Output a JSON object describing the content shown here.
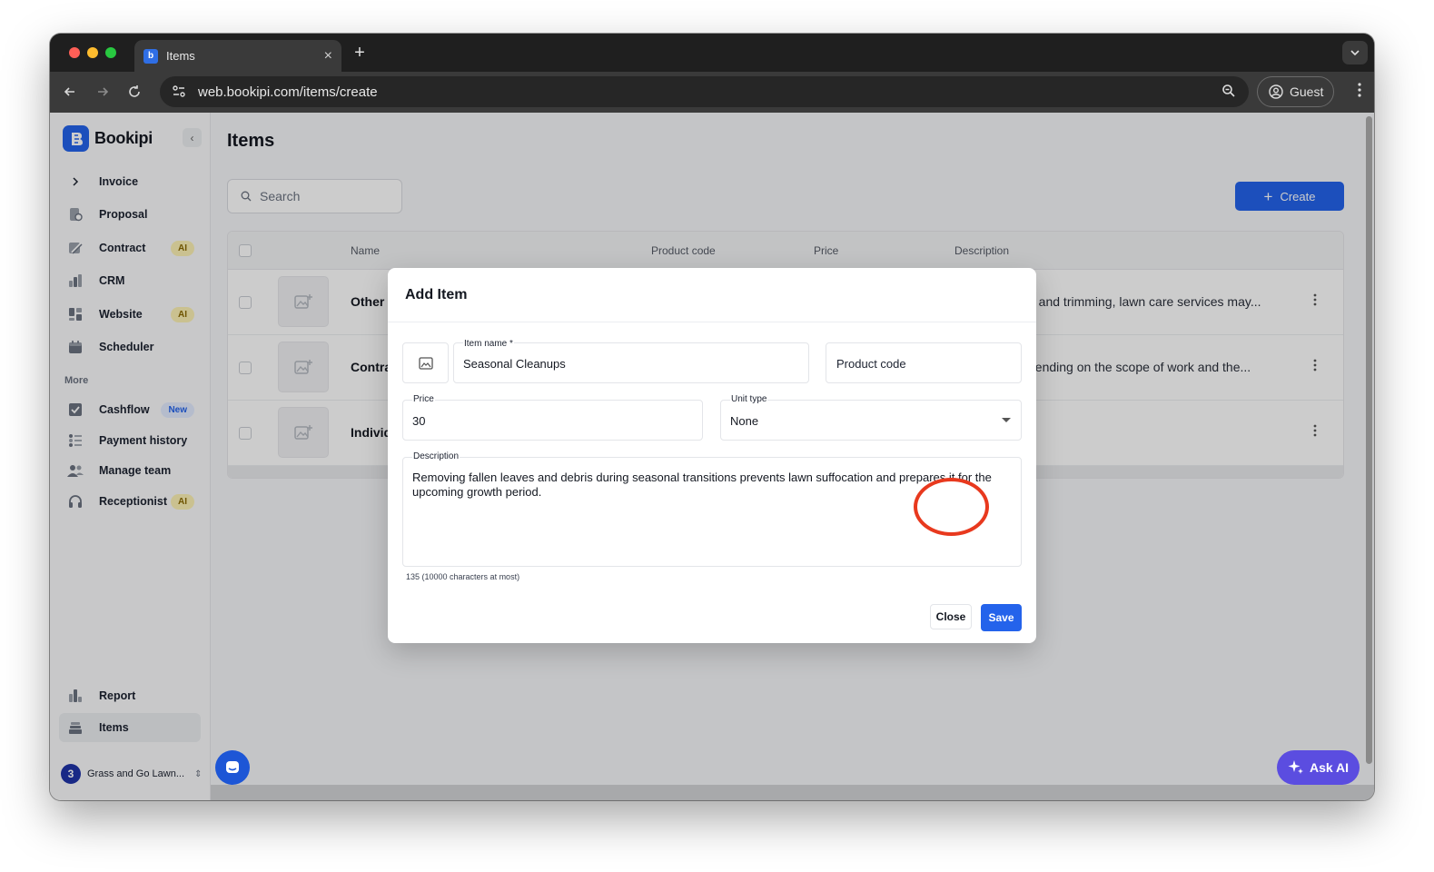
{
  "browser": {
    "tab_title": "Items",
    "tab_favicon_letter": "b",
    "new_tab_label": "+",
    "url": "web.bookipi.com/items/create",
    "profile_label": "Guest"
  },
  "sidebar": {
    "brand": "Bookipi",
    "items": [
      {
        "label": "Invoice",
        "icon": "chevron-right-icon"
      },
      {
        "label": "Proposal",
        "icon": "proposal-icon"
      },
      {
        "label": "Contract",
        "icon": "contract-icon",
        "badge": "AI"
      },
      {
        "label": "CRM",
        "icon": "crm-icon"
      },
      {
        "label": "Website",
        "icon": "website-icon",
        "badge": "AI"
      },
      {
        "label": "Scheduler",
        "icon": "scheduler-icon"
      }
    ],
    "more_label": "More",
    "more_items": [
      {
        "label": "Cashflow",
        "icon": "cashflow-icon",
        "badge": "New"
      },
      {
        "label": "Payment history",
        "icon": "payment-history-icon"
      },
      {
        "label": "Manage team",
        "icon": "team-icon"
      },
      {
        "label": "Receptionist",
        "icon": "headset-icon",
        "badge": "AI"
      }
    ],
    "bottom_items": [
      {
        "label": "Report",
        "icon": "report-icon"
      },
      {
        "label": "Items",
        "icon": "items-icon",
        "active": true
      }
    ],
    "org_name": "Grass and Go Lawn..."
  },
  "main": {
    "title": "Items",
    "search_placeholder": "Search",
    "create_label": "Create",
    "columns": [
      "Name",
      "Product code",
      "Price",
      "Description"
    ],
    "rows": [
      {
        "name": "Other S",
        "description": "g and trimming, lawn care services may..."
      },
      {
        "name": "Contra",
        "description": "pending on the scope of work and the..."
      },
      {
        "name": "Individ",
        "description": ""
      }
    ]
  },
  "modal": {
    "title": "Add Item",
    "item_name_label": "Item name *",
    "item_name_value": "Seasonal Cleanups",
    "product_code_placeholder": "Product code",
    "price_label": "Price",
    "price_value": "30",
    "unit_type_label": "Unit type",
    "unit_type_value": "None",
    "description_label": "Description",
    "description_value": "Removing fallen leaves and debris during seasonal transitions prevents lawn suffocation and prepares it for the upcoming growth period.",
    "char_count": "135 (10000 characters at most)",
    "close_label": "Close",
    "save_label": "Save"
  },
  "ask_ai_label": "Ask AI",
  "colors": {
    "accent": "#2463eb",
    "highlight": "#e8391e",
    "ask_ai": "#5b4de0"
  }
}
